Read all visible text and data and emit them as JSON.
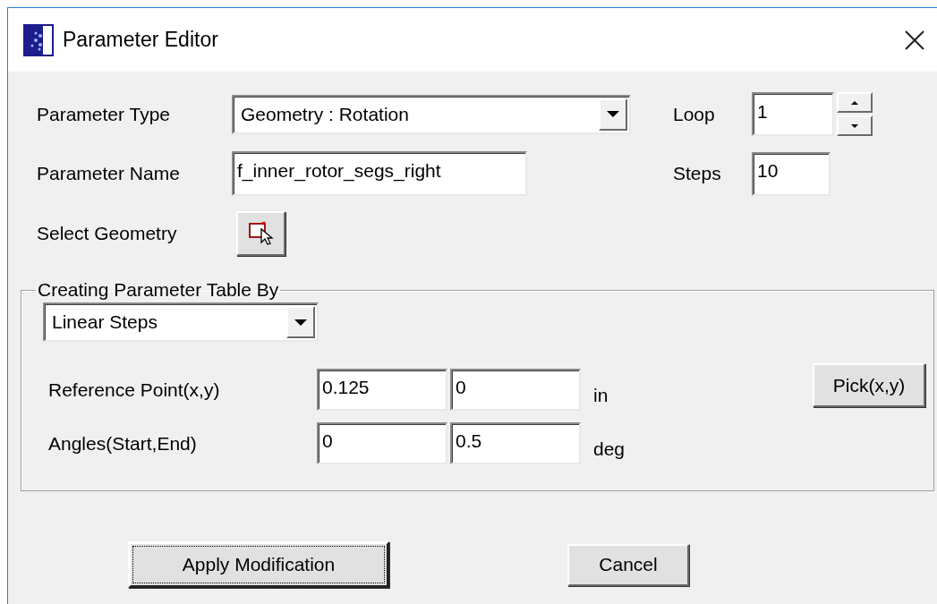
{
  "window": {
    "title": "Parameter Editor"
  },
  "parameter_type": {
    "label": "Parameter Type",
    "value": "Geometry : Rotation"
  },
  "loop": {
    "label": "Loop",
    "value": "1"
  },
  "parameter_name": {
    "label": "Parameter Name",
    "value": "f_inner_rotor_segs_right"
  },
  "steps": {
    "label": "Steps",
    "value": "10"
  },
  "select_geometry": {
    "label": "Select Geometry"
  },
  "table_group": {
    "title": "Creating Parameter Table By",
    "method": "Linear Steps",
    "pick_button": "Pick(x,y)",
    "rows": [
      {
        "label": "Reference Point(x,y)",
        "values": [
          "0.125",
          "0"
        ],
        "unit": "in"
      },
      {
        "label": "Angles(Start,End)",
        "values": [
          "0",
          "0.5"
        ],
        "unit": "deg"
      }
    ]
  },
  "buttons": [
    {
      "label": "Apply Modification",
      "focused": true
    },
    {
      "label": "Cancel",
      "focused": false
    }
  ]
}
